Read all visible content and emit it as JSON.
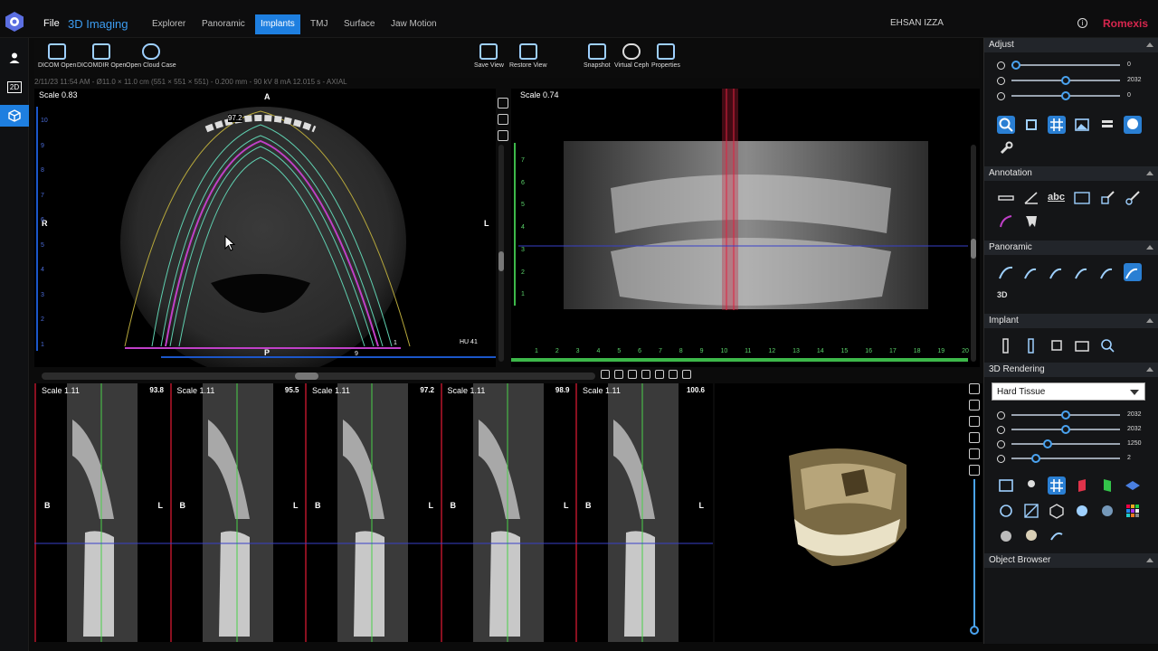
{
  "menu": {
    "file": "File",
    "title": "3D Imaging"
  },
  "tabs": [
    {
      "label": "Explorer"
    },
    {
      "label": "Panoramic"
    },
    {
      "label": "Implants"
    },
    {
      "label": "TMJ"
    },
    {
      "label": "Surface"
    },
    {
      "label": "Jaw Motion"
    }
  ],
  "active_tab": "Implants",
  "user": "EHSAN IZZA",
  "brand": "Romexis",
  "leftbar": {
    "two_d": "2D"
  },
  "toolbar": {
    "dicom_open": "DICOM Open",
    "dicomdir_open": "DICOMDIR Open",
    "open_cloud_case": "Open Cloud Case",
    "save_view": "Save View",
    "restore_view": "Restore View",
    "snapshot": "Snapshot",
    "virtual_ceph": "Virtual Ceph",
    "properties": "Properties"
  },
  "status_line": "2/11/23 11:54 AM - Ø11.0 × 11.0 cm (551 × 551 × 551) - 0.200 mm - 90 kV 8 mA 12.015 s - AXIAL",
  "axial": {
    "scale": "Scale 0.83",
    "top": "A",
    "left": "R",
    "right": "L",
    "bottom": "P",
    "marker": "97.2",
    "hu": "HU 41",
    "end_a": "1",
    "end_b": "9",
    "ruler": [
      "10",
      "9",
      "8",
      "7",
      "6",
      "5",
      "4",
      "3",
      "2",
      "1"
    ]
  },
  "pano": {
    "scale": "Scale 0.74",
    "ruler_x": [
      "1",
      "2",
      "3",
      "4",
      "5",
      "6",
      "7",
      "8",
      "9",
      "10",
      "11",
      "12",
      "13",
      "14",
      "15",
      "16",
      "17",
      "18",
      "19",
      "20"
    ],
    "ruler_y": [
      "7",
      "6",
      "5",
      "4",
      "3",
      "2",
      "1"
    ]
  },
  "cross_sections": [
    {
      "scale": "Scale 1.11",
      "value": "93.8",
      "left": "B",
      "right": "L"
    },
    {
      "scale": "Scale 1.11",
      "value": "95.5",
      "left": "B",
      "right": "L"
    },
    {
      "scale": "Scale 1.11",
      "value": "97.2",
      "left": "B",
      "right": "L"
    },
    {
      "scale": "Scale 1.11",
      "value": "98.9",
      "left": "B",
      "right": "L"
    },
    {
      "scale": "Scale 1.11",
      "value": "100.6",
      "left": "B",
      "right": "L"
    }
  ],
  "panel": {
    "adjust": {
      "title": "Adjust",
      "sliders": [
        {
          "value": "0",
          "level": 0.0
        },
        {
          "value": "2032",
          "level": 0.5
        },
        {
          "value": "0",
          "level": 0.5
        }
      ]
    },
    "annotation": "Annotation",
    "annotation_text_tool": "abc",
    "panoramic": "Panoramic",
    "panoramic_3d": "3D",
    "implant": "Implant",
    "rendering": {
      "title": "3D Rendering",
      "preset": "Hard Tissue",
      "sliders": [
        {
          "value": "2032",
          "level": 0.5
        },
        {
          "value": "2032",
          "level": 0.5
        },
        {
          "value": "1250",
          "level": 0.32
        },
        {
          "value": "2",
          "level": 0.2
        }
      ]
    },
    "object_browser": "Object Browser"
  }
}
